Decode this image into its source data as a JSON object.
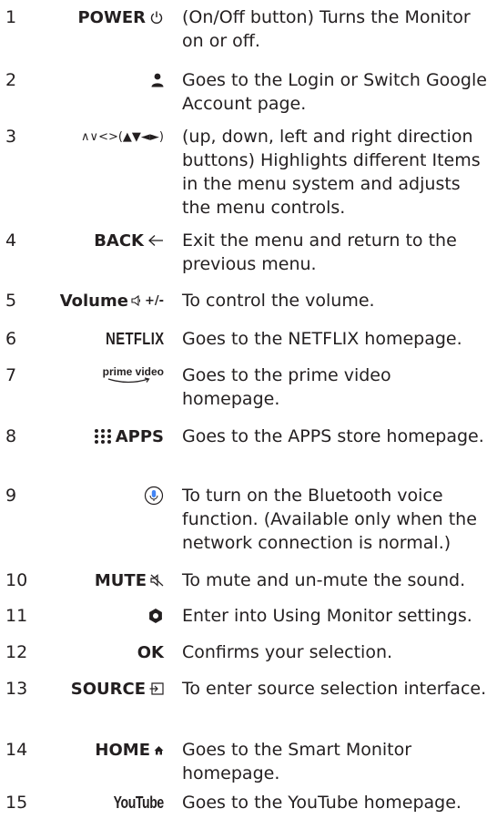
{
  "rows": [
    {
      "num": "1",
      "key": "POWER",
      "icon": "power-icon",
      "desc": "(On/Off button) Turns the Monitor on or off."
    },
    {
      "num": "2",
      "key": "",
      "icon": "person-icon",
      "desc": "Goes to the Login or Switch Google Account page."
    },
    {
      "num": "3",
      "key": "∧∨<>(▲▼◄►)",
      "icon": "",
      "desc": "(up, down, left and right direction buttons) Highlights different Items in the menu system and adjusts the menu controls."
    },
    {
      "num": "4",
      "key": "BACK",
      "icon": "back-arrow-icon",
      "desc": "Exit the menu and return to the previous menu."
    },
    {
      "num": "5",
      "key": "Volume",
      "key_suffix": "+/-",
      "icon": "speaker-icon",
      "desc": "To control the volume."
    },
    {
      "num": "6",
      "key": "NETFLIX",
      "icon": "netflix-logo",
      "desc": "Goes to the NETFLIX homepage."
    },
    {
      "num": "7",
      "key": "prime video",
      "icon": "prime-video-logo",
      "desc": "Goes to the prime video homepage."
    },
    {
      "num": "8",
      "key": "APPS",
      "icon": "apps-grid-icon",
      "desc": "Goes to the APPS store homepage."
    },
    {
      "num": "9",
      "key": "",
      "icon": "microphone-icon",
      "desc": "To turn on the Bluetooth voice function. (Available only when the network connection is normal.)"
    },
    {
      "num": "10",
      "key": "MUTE",
      "icon": "mute-icon",
      "desc": "To mute and un-mute the sound."
    },
    {
      "num": "11",
      "key": "",
      "icon": "settings-icon",
      "desc": "Enter into Using Monitor settings."
    },
    {
      "num": "12",
      "key": "OK",
      "icon": "",
      "desc": "Confirms your selection."
    },
    {
      "num": "13",
      "key": "SOURCE",
      "icon": "source-input-icon",
      "desc": "To enter source selection interface."
    },
    {
      "num": "14",
      "key": "HOME",
      "icon": "home-icon",
      "desc": "Goes to the Smart Monitor homepage."
    },
    {
      "num": "15",
      "key": "YouTube",
      "icon": "youtube-logo",
      "desc": "Goes to the YouTube homepage."
    }
  ]
}
